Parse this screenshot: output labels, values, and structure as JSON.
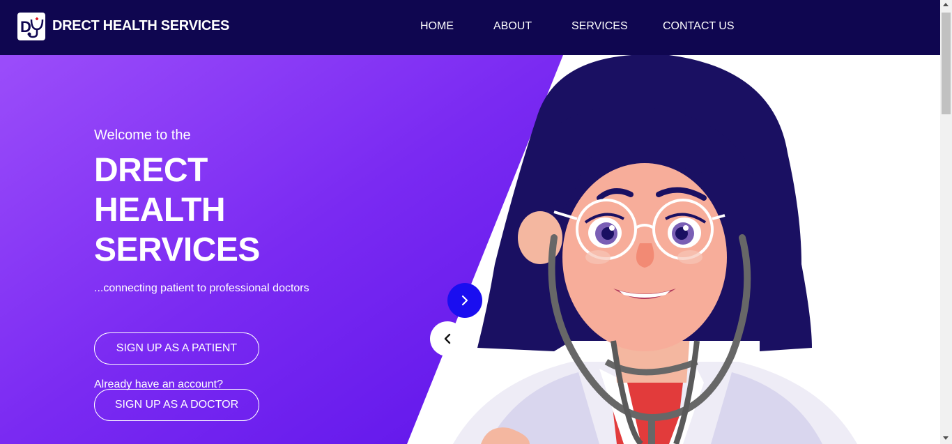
{
  "brand": {
    "name": "DRECT HEALTH SERVICES",
    "logo_icon": "stethoscope-logo-icon"
  },
  "nav": {
    "items": [
      {
        "label": "HOME"
      },
      {
        "label": "ABOUT"
      },
      {
        "label": "SERVICES"
      },
      {
        "label": "CONTACT US"
      }
    ]
  },
  "hero": {
    "welcome": "Welcome to the",
    "title_lines": [
      "DRECT",
      "HEALTH",
      "SERVICES"
    ],
    "tagline": "...connecting patient to professional doctors",
    "buttons": {
      "patient": "SIGN UP AS A PATIENT",
      "doctor": "SIGN UP AS A DOCTOR"
    },
    "account_text": "Already have an account?",
    "illustration": "female-doctor-illustration"
  },
  "carousel": {
    "next_icon": "chevron-right-icon",
    "prev_icon": "chevron-left-icon"
  },
  "colors": {
    "navbar": "#0f0650",
    "hero_gradient_start": "#9b4dfa",
    "hero_gradient_end": "#5e14ea",
    "accent_button": "#1a0ef0",
    "hair": "#1a1062"
  }
}
